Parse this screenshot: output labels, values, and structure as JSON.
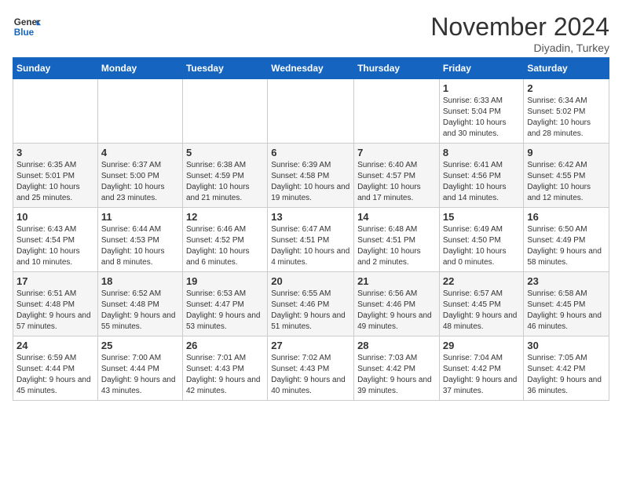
{
  "header": {
    "logo_line1": "General",
    "logo_line2": "Blue",
    "month": "November 2024",
    "location": "Diyadin, Turkey"
  },
  "days_of_week": [
    "Sunday",
    "Monday",
    "Tuesday",
    "Wednesday",
    "Thursday",
    "Friday",
    "Saturday"
  ],
  "weeks": [
    [
      {
        "day": "",
        "content": ""
      },
      {
        "day": "",
        "content": ""
      },
      {
        "day": "",
        "content": ""
      },
      {
        "day": "",
        "content": ""
      },
      {
        "day": "",
        "content": ""
      },
      {
        "day": "1",
        "content": "Sunrise: 6:33 AM\nSunset: 5:04 PM\nDaylight: 10 hours and 30 minutes."
      },
      {
        "day": "2",
        "content": "Sunrise: 6:34 AM\nSunset: 5:02 PM\nDaylight: 10 hours and 28 minutes."
      }
    ],
    [
      {
        "day": "3",
        "content": "Sunrise: 6:35 AM\nSunset: 5:01 PM\nDaylight: 10 hours and 25 minutes."
      },
      {
        "day": "4",
        "content": "Sunrise: 6:37 AM\nSunset: 5:00 PM\nDaylight: 10 hours and 23 minutes."
      },
      {
        "day": "5",
        "content": "Sunrise: 6:38 AM\nSunset: 4:59 PM\nDaylight: 10 hours and 21 minutes."
      },
      {
        "day": "6",
        "content": "Sunrise: 6:39 AM\nSunset: 4:58 PM\nDaylight: 10 hours and 19 minutes."
      },
      {
        "day": "7",
        "content": "Sunrise: 6:40 AM\nSunset: 4:57 PM\nDaylight: 10 hours and 17 minutes."
      },
      {
        "day": "8",
        "content": "Sunrise: 6:41 AM\nSunset: 4:56 PM\nDaylight: 10 hours and 14 minutes."
      },
      {
        "day": "9",
        "content": "Sunrise: 6:42 AM\nSunset: 4:55 PM\nDaylight: 10 hours and 12 minutes."
      }
    ],
    [
      {
        "day": "10",
        "content": "Sunrise: 6:43 AM\nSunset: 4:54 PM\nDaylight: 10 hours and 10 minutes."
      },
      {
        "day": "11",
        "content": "Sunrise: 6:44 AM\nSunset: 4:53 PM\nDaylight: 10 hours and 8 minutes."
      },
      {
        "day": "12",
        "content": "Sunrise: 6:46 AM\nSunset: 4:52 PM\nDaylight: 10 hours and 6 minutes."
      },
      {
        "day": "13",
        "content": "Sunrise: 6:47 AM\nSunset: 4:51 PM\nDaylight: 10 hours and 4 minutes."
      },
      {
        "day": "14",
        "content": "Sunrise: 6:48 AM\nSunset: 4:51 PM\nDaylight: 10 hours and 2 minutes."
      },
      {
        "day": "15",
        "content": "Sunrise: 6:49 AM\nSunset: 4:50 PM\nDaylight: 10 hours and 0 minutes."
      },
      {
        "day": "16",
        "content": "Sunrise: 6:50 AM\nSunset: 4:49 PM\nDaylight: 9 hours and 58 minutes."
      }
    ],
    [
      {
        "day": "17",
        "content": "Sunrise: 6:51 AM\nSunset: 4:48 PM\nDaylight: 9 hours and 57 minutes."
      },
      {
        "day": "18",
        "content": "Sunrise: 6:52 AM\nSunset: 4:48 PM\nDaylight: 9 hours and 55 minutes."
      },
      {
        "day": "19",
        "content": "Sunrise: 6:53 AM\nSunset: 4:47 PM\nDaylight: 9 hours and 53 minutes."
      },
      {
        "day": "20",
        "content": "Sunrise: 6:55 AM\nSunset: 4:46 PM\nDaylight: 9 hours and 51 minutes."
      },
      {
        "day": "21",
        "content": "Sunrise: 6:56 AM\nSunset: 4:46 PM\nDaylight: 9 hours and 49 minutes."
      },
      {
        "day": "22",
        "content": "Sunrise: 6:57 AM\nSunset: 4:45 PM\nDaylight: 9 hours and 48 minutes."
      },
      {
        "day": "23",
        "content": "Sunrise: 6:58 AM\nSunset: 4:45 PM\nDaylight: 9 hours and 46 minutes."
      }
    ],
    [
      {
        "day": "24",
        "content": "Sunrise: 6:59 AM\nSunset: 4:44 PM\nDaylight: 9 hours and 45 minutes."
      },
      {
        "day": "25",
        "content": "Sunrise: 7:00 AM\nSunset: 4:44 PM\nDaylight: 9 hours and 43 minutes."
      },
      {
        "day": "26",
        "content": "Sunrise: 7:01 AM\nSunset: 4:43 PM\nDaylight: 9 hours and 42 minutes."
      },
      {
        "day": "27",
        "content": "Sunrise: 7:02 AM\nSunset: 4:43 PM\nDaylight: 9 hours and 40 minutes."
      },
      {
        "day": "28",
        "content": "Sunrise: 7:03 AM\nSunset: 4:42 PM\nDaylight: 9 hours and 39 minutes."
      },
      {
        "day": "29",
        "content": "Sunrise: 7:04 AM\nSunset: 4:42 PM\nDaylight: 9 hours and 37 minutes."
      },
      {
        "day": "30",
        "content": "Sunrise: 7:05 AM\nSunset: 4:42 PM\nDaylight: 9 hours and 36 minutes."
      }
    ]
  ]
}
